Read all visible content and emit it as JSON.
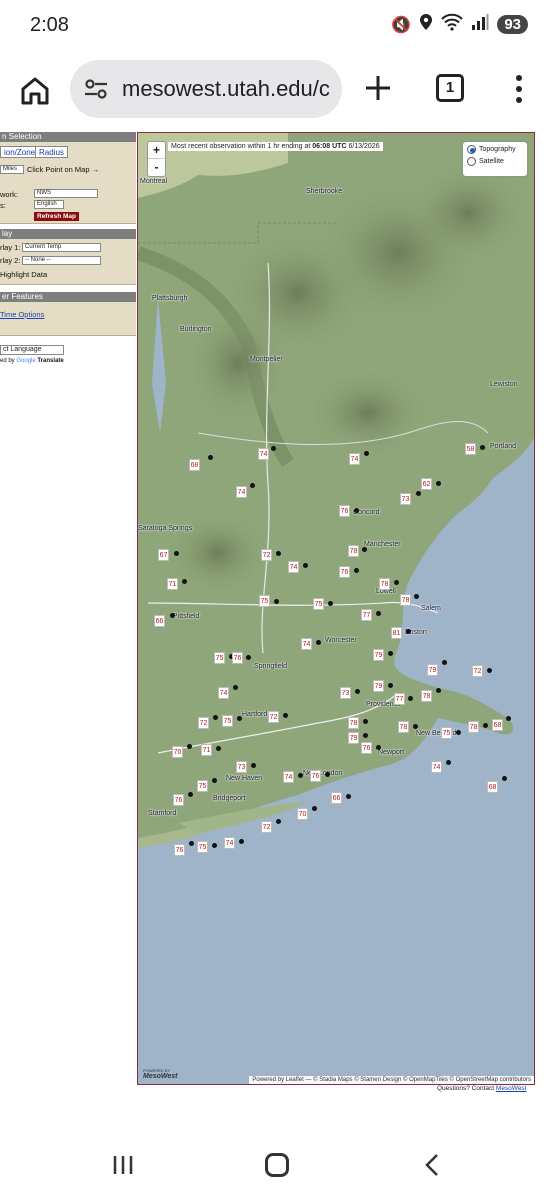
{
  "status": {
    "time": "2:08",
    "signal_badge": "6",
    "battery": "93"
  },
  "browser": {
    "url": "mesowest.utah.edu/c",
    "tab_count": "1"
  },
  "sidebar": {
    "selection_header": "n Selection",
    "tab_zone": "ion/Zone",
    "tab_radius": "Radius",
    "miles_select": "Miles",
    "click_point": "Click Point on Map →",
    "network_label": "work:",
    "network_value": "NWS",
    "units_label": "s:",
    "units_value": "English",
    "refresh_button": "Refresh Map",
    "display_header": "lay",
    "overlay1_label": "rlay 1:",
    "overlay1_value": "Current Temp",
    "overlay2_label": "rlay 2:",
    "overlay2_value": "-- None --",
    "highlight": "Highlight Data",
    "other_header": "er Features",
    "time_options": "Time Options",
    "language_select": "ct Language",
    "powered_translate": "ed by",
    "google": "Google",
    "translate": "Translate"
  },
  "map": {
    "zoom_in": "+",
    "zoom_out": "-",
    "banner_prefix": "Most recent observation within 1 hr ending at",
    "banner_time": "06:08 UTC",
    "banner_date": "6/13/2026",
    "layer_topo": "Topography",
    "layer_sat": "Satellite",
    "powered_by": "POWERED BY",
    "logo": "MesoWest",
    "attribution": "Powered by Leaflet — © Stadia Maps © Stamen Design © OpenMapTiles © OpenStreetMap contributors",
    "cities": [
      {
        "name": "Montreal"
      },
      {
        "name": "Sherbrooke"
      },
      {
        "name": "Plattsburgh"
      },
      {
        "name": "Burlington"
      },
      {
        "name": "Montpelier"
      },
      {
        "name": "Lewiston"
      },
      {
        "name": "Portland"
      },
      {
        "name": "Concord"
      },
      {
        "name": "Manchester"
      },
      {
        "name": "Lowell"
      },
      {
        "name": "Salem"
      },
      {
        "name": "Boston"
      },
      {
        "name": "Pittsfield"
      },
      {
        "name": "Springfield"
      },
      {
        "name": "Worcester"
      },
      {
        "name": "Providence"
      },
      {
        "name": "New Bedford"
      },
      {
        "name": "Newport"
      },
      {
        "name": "Hartford"
      },
      {
        "name": "New Haven"
      },
      {
        "name": "Bridgeport"
      },
      {
        "name": "Stamford"
      },
      {
        "name": "New London"
      },
      {
        "name": "Saratoga Springs"
      }
    ],
    "stations": [
      {
        "temp": "74"
      },
      {
        "temp": "68"
      },
      {
        "temp": "74"
      },
      {
        "temp": "74"
      },
      {
        "temp": "58"
      },
      {
        "temp": "62"
      },
      {
        "temp": "73"
      },
      {
        "temp": "76"
      },
      {
        "temp": "78"
      },
      {
        "temp": "67"
      },
      {
        "temp": "72"
      },
      {
        "temp": "74"
      },
      {
        "temp": "76"
      },
      {
        "temp": "71"
      },
      {
        "temp": "78"
      },
      {
        "temp": "78"
      },
      {
        "temp": "66"
      },
      {
        "temp": "75"
      },
      {
        "temp": "75"
      },
      {
        "temp": "77"
      },
      {
        "temp": "81"
      },
      {
        "temp": "74"
      },
      {
        "temp": "79"
      },
      {
        "temp": "75"
      },
      {
        "temp": "76"
      },
      {
        "temp": "79"
      },
      {
        "temp": "72"
      },
      {
        "temp": "74"
      },
      {
        "temp": "73"
      },
      {
        "temp": "79"
      },
      {
        "temp": "77"
      },
      {
        "temp": "78"
      },
      {
        "temp": "72"
      },
      {
        "temp": "75"
      },
      {
        "temp": "72"
      },
      {
        "temp": "78"
      },
      {
        "temp": "79"
      },
      {
        "temp": "76"
      },
      {
        "temp": "78"
      },
      {
        "temp": "75"
      },
      {
        "temp": "78"
      },
      {
        "temp": "68"
      },
      {
        "temp": "70"
      },
      {
        "temp": "71"
      },
      {
        "temp": "73"
      },
      {
        "temp": "74"
      },
      {
        "temp": "76"
      },
      {
        "temp": "74"
      },
      {
        "temp": "75"
      },
      {
        "temp": "76"
      },
      {
        "temp": "66"
      },
      {
        "temp": "68"
      },
      {
        "temp": "70"
      },
      {
        "temp": "72"
      },
      {
        "temp": "76"
      },
      {
        "temp": "75"
      },
      {
        "temp": "74"
      }
    ]
  },
  "footer": {
    "questions": "Questions? Contact",
    "contact_link": "MesoWest"
  }
}
